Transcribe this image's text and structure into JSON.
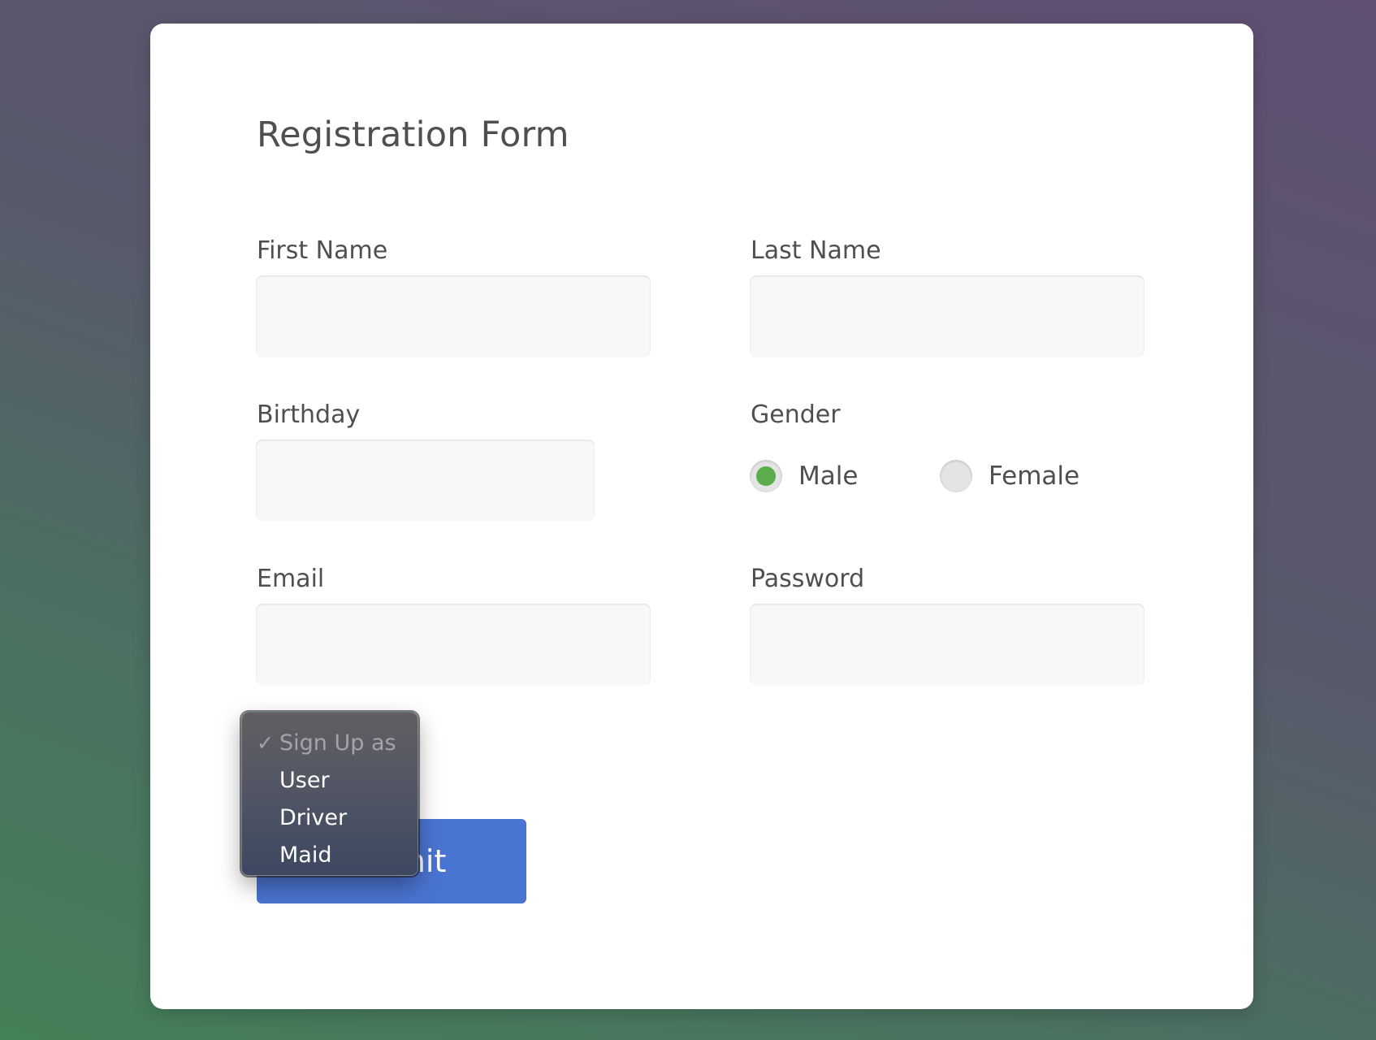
{
  "form": {
    "title": "Registration Form",
    "fields": {
      "first_name": {
        "label": "First Name",
        "value": ""
      },
      "last_name": {
        "label": "Last Name",
        "value": ""
      },
      "birthday": {
        "label": "Birthday",
        "value": ""
      },
      "email": {
        "label": "Email",
        "value": ""
      },
      "password": {
        "label": "Password",
        "value": ""
      }
    },
    "gender": {
      "label": "Gender",
      "options": [
        {
          "label": "Male",
          "selected": true
        },
        {
          "label": "Female",
          "selected": false
        }
      ]
    },
    "signup_select": {
      "selected": "Sign Up as",
      "options": [
        {
          "label": "Sign Up as",
          "checked": true,
          "disabled": true
        },
        {
          "label": "User",
          "checked": false,
          "disabled": false
        },
        {
          "label": "Driver",
          "checked": false,
          "disabled": false
        },
        {
          "label": "Maid",
          "checked": false,
          "disabled": false
        }
      ],
      "check_glyph": "✓"
    },
    "submit_label": "Submit"
  },
  "colors": {
    "accent": "#4a74d1",
    "radio_selected": "#5aad4a",
    "text": "#4f4f4f"
  },
  "icons": {
    "radio_selected": "radio-selected-icon",
    "radio_unselected": "radio-unselected-icon",
    "check": "checkmark-icon"
  }
}
